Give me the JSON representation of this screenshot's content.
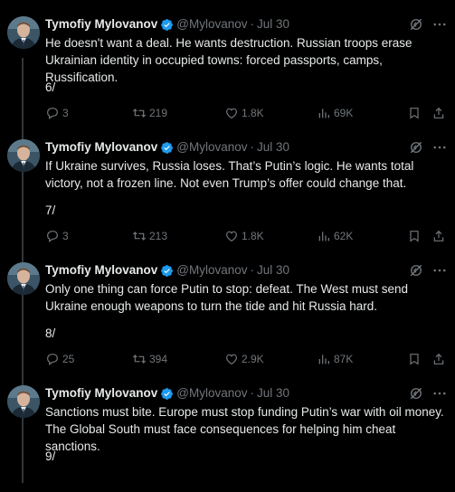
{
  "author": {
    "name": "Tymofiy Mylovanov",
    "handle": "@Mylovanov",
    "time": "Jul 30"
  },
  "tweets": [
    {
      "body": "He doesn't want a deal. He wants destruction. Russian troops erase Ukrainian identity in occupied towns: forced passports, camps, Russification.",
      "num": "6/",
      "replies": "3",
      "retweets": "219",
      "likes": "1.8K",
      "views": "69K"
    },
    {
      "body": "If Ukraine survives, Russia loses. That’s Putin’s logic. He wants total victory, not a frozen line. Not even Trump’s offer could change that.",
      "num": "7/",
      "replies": "3",
      "retweets": "213",
      "likes": "1.8K",
      "views": "62K"
    },
    {
      "body": "Only one thing can force Putin to stop: defeat. The West must send Ukraine enough weapons to turn the tide and hit Russia hard.",
      "num": "8/",
      "replies": "25",
      "retweets": "394",
      "likes": "2.9K",
      "views": "87K"
    },
    {
      "body": "Sanctions must bite. Europe must stop funding Putin’s war with oil money. The Global South must face consequences for helping him cheat sanctions.",
      "num": "9/",
      "replies": "",
      "retweets": "",
      "likes": "",
      "views": ""
    }
  ],
  "colors": {
    "background": "#000000",
    "text": "#e7e9ea",
    "secondary": "#71767b",
    "verified": "#1d9bf0",
    "thread_line": "#333639"
  },
  "icons": [
    "verified-badge-icon",
    "grok-icon",
    "more-icon",
    "reply-icon",
    "retweet-icon",
    "like-icon",
    "views-icon",
    "bookmark-icon",
    "share-icon"
  ]
}
